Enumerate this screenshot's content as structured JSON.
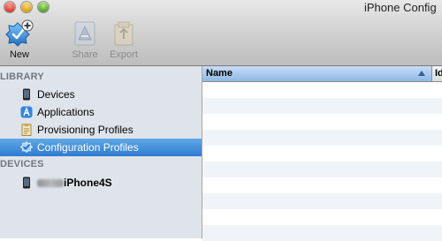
{
  "window": {
    "title": "iPhone Config"
  },
  "toolbar": {
    "new_label": "New",
    "share_label": "Share",
    "export_label": "Export"
  },
  "sidebar": {
    "library_header": "LIBRARY",
    "library_items": [
      {
        "label": "Devices",
        "icon": "iphone-icon"
      },
      {
        "label": "Applications",
        "icon": "app-store-icon"
      },
      {
        "label": "Provisioning Profiles",
        "icon": "provisioning-profile-icon"
      },
      {
        "label": "Configuration Profiles",
        "icon": "configuration-profile-icon",
        "selected": true
      }
    ],
    "devices_header": "DEVICES",
    "device_items": [
      {
        "label": "iPhone4S",
        "icon": "iphone-icon"
      }
    ]
  },
  "table": {
    "columns": [
      {
        "label": "Name",
        "sorted": "ascending"
      },
      {
        "label": "Id"
      }
    ],
    "rows": []
  },
  "colors": {
    "selection": "#3c8ad8",
    "sidebar_bg": "#dfe4ea",
    "header_selected": "#a8c8ec"
  }
}
